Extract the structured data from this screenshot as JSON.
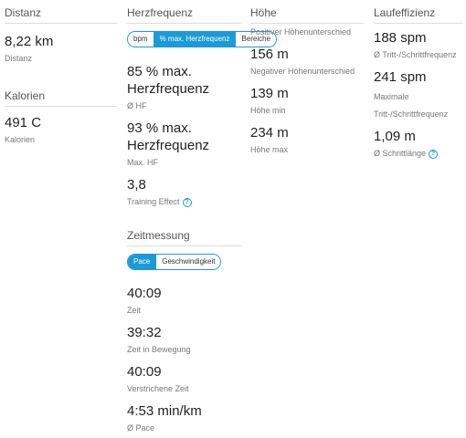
{
  "distance": {
    "title": "Distanz",
    "value": "8,22 km",
    "label": "Distanz"
  },
  "calories": {
    "title": "Kalorien",
    "value": "491 C",
    "label": "Kalorien"
  },
  "heart_rate": {
    "title": "Herzfrequenz",
    "toggle": [
      "bpm",
      "% max. Herzfrequenz",
      "Bereiche"
    ],
    "active_index": 1,
    "metrics": [
      {
        "value": "85 % max. Herzfrequenz",
        "label": "Ø HF"
      },
      {
        "value": "93 % max. Herzfrequenz",
        "label": "Max. HF"
      },
      {
        "value": "3,8",
        "label": "Training Effect"
      }
    ]
  },
  "timing": {
    "title": "Zeitmessung",
    "toggle": [
      "Pace",
      "Geschwindigkeit"
    ],
    "active_index": 0,
    "metrics": [
      {
        "value": "40:09",
        "label": "Zeit"
      },
      {
        "value": "39:32",
        "label": "Zeit in Bewegung"
      },
      {
        "value": "40:09",
        "label": "Verstrichene Zeit"
      },
      {
        "value": "4:53 min/km",
        "label": "Ø Pace"
      }
    ]
  },
  "elevation": {
    "title": "Höhe",
    "metrics": [
      {
        "value": "",
        "label": "Positiver Höhenunterschied"
      },
      {
        "value": "156 m",
        "label": "Negativer Höhenunterschied"
      },
      {
        "value": "139 m",
        "label": "Höhe min"
      },
      {
        "value": "234 m",
        "label": "Höhe max"
      }
    ]
  },
  "efficiency": {
    "title": "Laufeffizienz",
    "metrics": [
      {
        "value": "188 spm",
        "label": "Ø Tritt-/Schrittfrequenz"
      },
      {
        "value": "241 spm",
        "label": "Maximale Tritt-/Schrittfrequenz"
      },
      {
        "value": "1,09 m",
        "label": "Ø Schrittlänge"
      }
    ]
  },
  "colors": {
    "accent": "#1a9bd7",
    "divider": "#dcdcdc"
  },
  "icons": {
    "help": "help-circle-icon"
  },
  "help_glyph": "?"
}
